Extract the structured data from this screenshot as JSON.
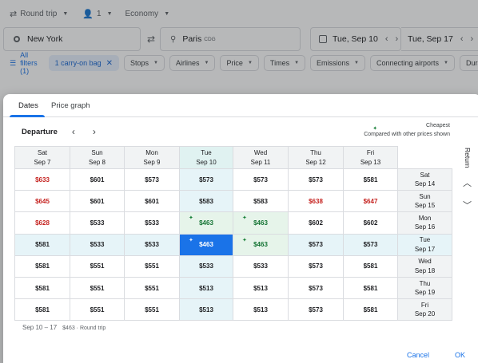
{
  "header": {
    "trip_type": "Round trip",
    "passengers": "1",
    "cabin": "Economy"
  },
  "search": {
    "origin": "New York",
    "destination": "Paris",
    "destination_code": "CDG",
    "departure_date": "Tue, Sep 10",
    "return_date": "Tue, Sep 17"
  },
  "filters": {
    "all_filters": "All filters (1)",
    "active_chip": "1 carry-on bag",
    "chips": [
      "Stops",
      "Airlines",
      "Price",
      "Times",
      "Emissions",
      "Connecting airports",
      "Durati"
    ]
  },
  "dialog": {
    "tabs": [
      "Dates",
      "Price graph"
    ],
    "active_tab": "Dates",
    "departure_label": "Departure",
    "legend_title": "Cheapest",
    "legend_sub": "Compared with other prices shown",
    "return_label": "Return",
    "departure_days": [
      {
        "dow": "Sat",
        "date": "Sep 7"
      },
      {
        "dow": "Sun",
        "date": "Sep 8"
      },
      {
        "dow": "Mon",
        "date": "Sep 9"
      },
      {
        "dow": "Tue",
        "date": "Sep 10"
      },
      {
        "dow": "Wed",
        "date": "Sep 11"
      },
      {
        "dow": "Thu",
        "date": "Sep 12"
      },
      {
        "dow": "Fri",
        "date": "Sep 13"
      }
    ],
    "return_days": [
      {
        "dow": "Sat",
        "date": "Sep 14"
      },
      {
        "dow": "Sun",
        "date": "Sep 15"
      },
      {
        "dow": "Mon",
        "date": "Sep 16"
      },
      {
        "dow": "Tue",
        "date": "Sep 17"
      },
      {
        "dow": "Wed",
        "date": "Sep 18"
      },
      {
        "dow": "Thu",
        "date": "Sep 19"
      },
      {
        "dow": "Fri",
        "date": "Sep 20"
      }
    ],
    "prices": [
      [
        "$633",
        "$601",
        "$573",
        "$573",
        "$573",
        "$573",
        "$581"
      ],
      [
        "$645",
        "$601",
        "$601",
        "$583",
        "$583",
        "$638",
        "$647"
      ],
      [
        "$628",
        "$533",
        "$533",
        "$463",
        "$463",
        "$602",
        "$602"
      ],
      [
        "$581",
        "$533",
        "$533",
        "$463",
        "$463",
        "$573",
        "$573"
      ],
      [
        "$581",
        "$551",
        "$551",
        "$533",
        "$533",
        "$573",
        "$581"
      ],
      [
        "$581",
        "$551",
        "$551",
        "$513",
        "$513",
        "$573",
        "$581"
      ],
      [
        "$581",
        "$551",
        "$551",
        "$513",
        "$513",
        "$573",
        "$581"
      ]
    ],
    "high_cells": [
      [
        0,
        0
      ],
      [
        1,
        0
      ],
      [
        2,
        0
      ],
      [
        1,
        5
      ],
      [
        1,
        6
      ]
    ],
    "cheapest_cells": [
      [
        2,
        3
      ],
      [
        2,
        4
      ],
      [
        3,
        3
      ],
      [
        3,
        4
      ]
    ],
    "selected_cell": [
      3,
      3
    ],
    "selected_departure_index": 3,
    "selected_return_index": 3,
    "summary_dates": "Sep 10 – 17",
    "summary_price": "$463 · Round trip",
    "cancel_label": "Cancel",
    "ok_label": "OK"
  },
  "colors": {
    "accent": "#1a73e8",
    "high_price": "#c5221f",
    "cheap_price": "#137333",
    "cheap_bg": "#e6f4ea",
    "selected_band": "#e6f4f8",
    "selected_bg": "#1a73e8"
  }
}
